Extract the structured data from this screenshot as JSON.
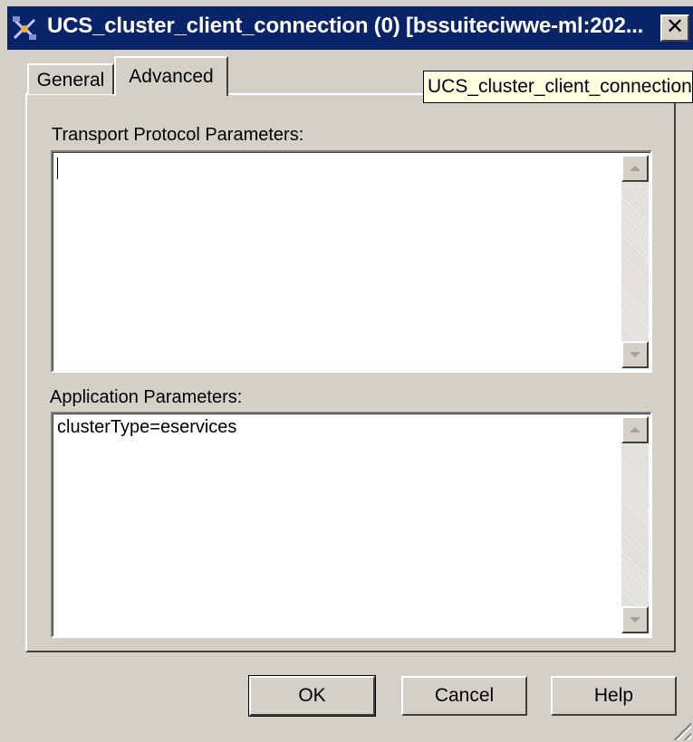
{
  "window": {
    "title": "UCS_cluster_client_connection (0) [bssuiteciwwe-ml:202...",
    "close_label": "✕",
    "icon": "connection-icon",
    "accent_color": "#0a246a"
  },
  "tabs": [
    {
      "label": "General",
      "selected": false
    },
    {
      "label": "Advanced",
      "selected": true
    }
  ],
  "tooltip": {
    "text": "UCS_cluster_client_connection"
  },
  "transport": {
    "label": "Transport Protocol Parameters:",
    "value": ""
  },
  "application": {
    "label": "Application Parameters:",
    "value": "clusterType=eservices"
  },
  "buttons": {
    "ok": "OK",
    "cancel": "Cancel",
    "help": "Help"
  }
}
